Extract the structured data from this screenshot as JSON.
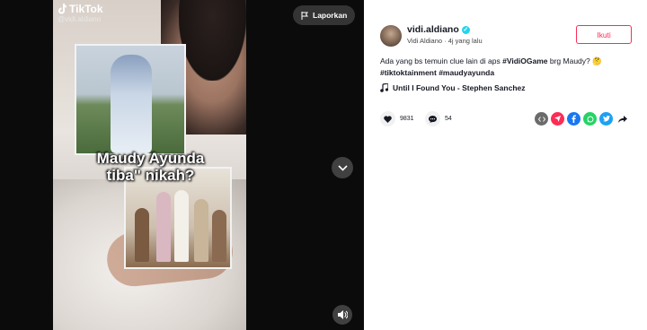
{
  "video": {
    "brand": "TikTok",
    "handle": "@vidi.aldiano",
    "title_line1": "Maudy Ayunda",
    "title_line2": "tiba\" nikah?",
    "report_label": "Laporkan"
  },
  "post": {
    "username": "vidi.aldiano",
    "display_name": "Vidi Aldiano",
    "time_ago": "4j yang lalu",
    "follow_label": "Ikuti",
    "caption_text": "Ada yang bs temuin clue lain di aps ",
    "caption_tag1": "#VidiOGame",
    "caption_mid": " brg Maudy? 🤔",
    "caption_tag2": "#tiktoktainment",
    "caption_tag3": "#maudyayunda",
    "music": "Until I Found You - Stephen Sanchez",
    "likes": "9831",
    "comments": "54"
  },
  "icons": {
    "share_colors": [
      "#6b6b6b",
      "#fe2c55",
      "#1877f2",
      "#25d366",
      "#1da1f2"
    ]
  }
}
